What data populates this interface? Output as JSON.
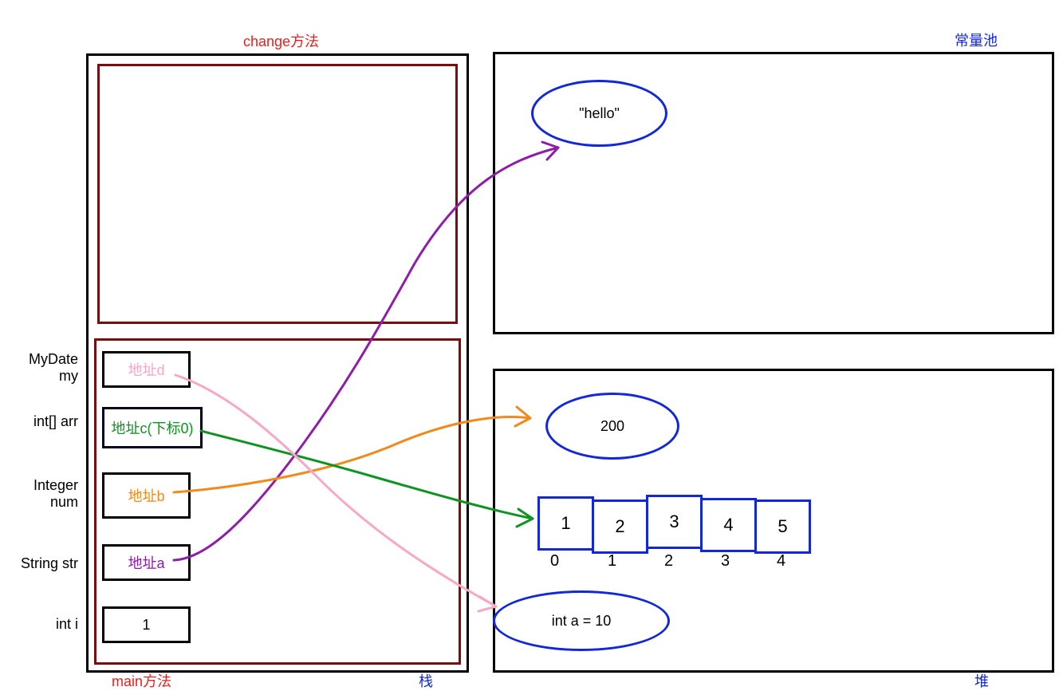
{
  "labels": {
    "change_method": "change方法",
    "main_method": "main方法",
    "stack": "栈",
    "heap": "堆",
    "const_pool": "常量池"
  },
  "stack": {
    "vars": {
      "mydate_my": {
        "label_line1": "MyDate",
        "label_line2": "my",
        "box_text": "地址d",
        "text_color": "#f7a8c7"
      },
      "intarr": {
        "label_line1": "int[] arr",
        "box_text": "地址c(下标0)",
        "text_color": "#0f9322"
      },
      "integer_num": {
        "label_line1": "Integer",
        "label_line2": "num",
        "box_text": "地址b",
        "text_color": "#f08a1c"
      },
      "string_str": {
        "label_line1": "String str",
        "box_text": "地址a",
        "text_color": "#8e1da8"
      },
      "int_i": {
        "label_line1": "int i",
        "box_text": "1",
        "text_color": "#000"
      }
    }
  },
  "heap": {
    "ellipse_200": "200",
    "ellipse_inta": "int a = 10",
    "array": {
      "values": [
        "1",
        "2",
        "3",
        "4",
        "5"
      ],
      "indices": [
        "0",
        "1",
        "2",
        "3",
        "4"
      ]
    }
  },
  "const_pool": {
    "hello": "\"hello\""
  }
}
